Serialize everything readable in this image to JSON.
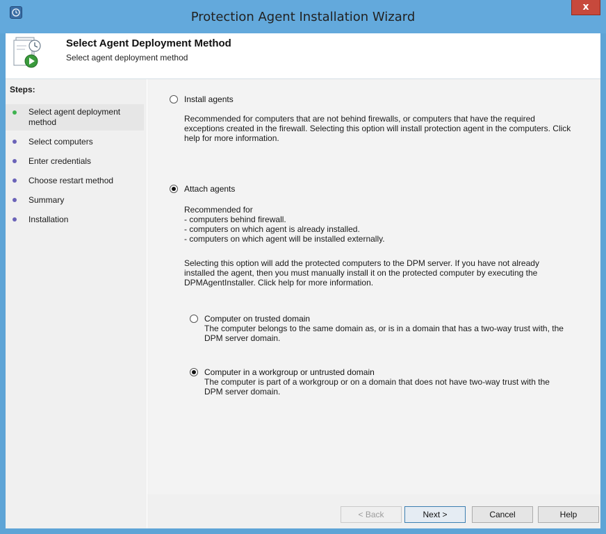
{
  "window": {
    "title": "Protection Agent Installation Wizard",
    "close_label": "x",
    "accent": "#63a9dc"
  },
  "header": {
    "title": "Select Agent Deployment Method",
    "subtitle": "Select agent deployment method"
  },
  "sidebar": {
    "heading": "Steps:",
    "items": [
      {
        "label": "Select agent deployment method",
        "current": true
      },
      {
        "label": "Select computers"
      },
      {
        "label": "Enter credentials"
      },
      {
        "label": "Choose restart method"
      },
      {
        "label": "Summary"
      },
      {
        "label": "Installation"
      }
    ]
  },
  "options": {
    "install": {
      "label": "Install agents",
      "selected": false,
      "description": "Recommended for computers that are not behind firewalls, or computers that have the required\nexceptions created in the firewall. Selecting this option will install protection agent in the computers. Click\nhelp for more information."
    },
    "attach": {
      "label": "Attach agents",
      "selected": true,
      "description": "Recommended for\n- computers behind firewall.\n- computers on which agent is already installed.\n- computers on which agent will be installed externally.",
      "description2": "Selecting this option will add the protected computers to the DPM server. If you have not already\ninstalled the agent, then you must manually install it on the protected computer by executing the\nDPMAgentInstaller. Click help for more information.",
      "sub_options": {
        "trusted": {
          "label": "Computer on trusted domain",
          "selected": false,
          "description": "The computer belongs to the same domain as, or is in a domain that has a two-way trust with, the\nDPM server domain."
        },
        "workgroup": {
          "label": "Computer in a workgroup or untrusted domain",
          "selected": true,
          "description": "The computer is part of a workgroup or on a domain that does not have two-way trust with the\nDPM server domain."
        }
      }
    }
  },
  "footer": {
    "back_label": "< Back",
    "next_label": "Next >",
    "cancel_label": "Cancel",
    "help_label": "Help"
  }
}
